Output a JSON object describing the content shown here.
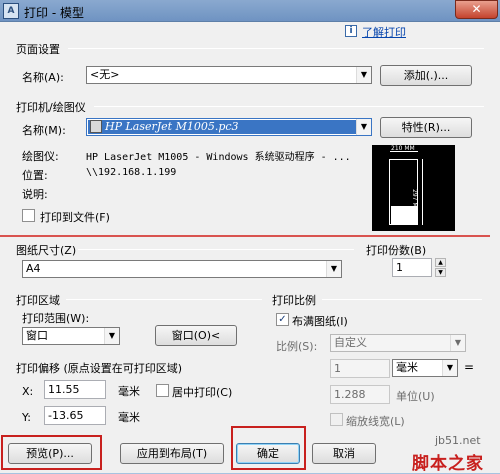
{
  "window": {
    "title": "打印 - 模型",
    "close": "✕"
  },
  "help": {
    "link": "了解打印",
    "icon": "i"
  },
  "page_setup": {
    "title": "页面设置",
    "name_label": "名称(A):",
    "name_value": "<无>",
    "add_button": "添加(.)..."
  },
  "printer": {
    "title": "打印机/绘图仪",
    "name_label": "名称(M):",
    "name_value": "HP LaserJet M1005.pc3",
    "properties_button": "特性(R)...",
    "plotter_label": "绘图仪:",
    "plotter_value": "HP LaserJet M1005 - Windows 系统驱动程序 - ...",
    "location_label": "位置:",
    "location_value": "\\\\192.168.1.199",
    "description_label": "说明:",
    "print_to_file_label": "打印到文件(F)",
    "preview_width": "210 MM",
    "preview_height": "297 MM"
  },
  "paper_size": {
    "title": "图纸尺寸(Z)",
    "value": "A4"
  },
  "copies": {
    "title": "打印份数(B)",
    "value": "1"
  },
  "print_area": {
    "title": "打印区域",
    "range_label": "打印范围(W):",
    "range_value": "窗口",
    "window_button": "窗口(O)<"
  },
  "print_scale": {
    "title": "打印比例",
    "fit_label": "布满图纸(I)",
    "scale_label": "比例(S):",
    "scale_value": "自定义",
    "value1": "1",
    "unit_value": "毫米",
    "value2": "1.288",
    "unit_label": "单位(U)",
    "lineweights_label": "缩放线宽(L)"
  },
  "print_offset": {
    "title": "打印偏移 (原点设置在可打印区域)",
    "x_label": "X:",
    "x_value": "11.55",
    "x_unit": "毫米",
    "center_label": "居中打印(C)",
    "y_label": "Y:",
    "y_value": "-13.65",
    "y_unit": "毫米"
  },
  "buttons": {
    "preview": "预览(P)...",
    "apply": "应用到布局(T)",
    "ok": "确定",
    "cancel": "取消"
  },
  "watermark": {
    "site": "jb51.net",
    "name": "脚本之家"
  },
  "colors": {
    "highlight": "#c8201e",
    "selection": "#3a75c4"
  }
}
